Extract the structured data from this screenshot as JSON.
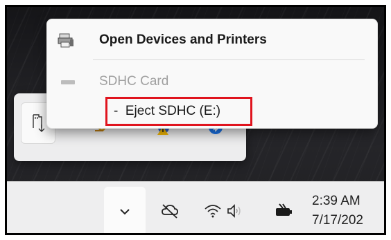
{
  "context_menu": {
    "open_devices_label": "Open Devices and Printers",
    "device_label": "SDHC Card",
    "eject_label": "-  Eject SDHC (E:)"
  },
  "taskbar": {
    "time": "2:39 AM",
    "date": "7/17/202"
  },
  "icons": {
    "open_devices": "devices-printers-icon",
    "sd_card": "sd-card-icon",
    "usb_eject": "usb-eject-icon",
    "chevron": "chevron-down-icon",
    "onedrive": "onedrive-offline-icon",
    "wifi": "wifi-icon",
    "volume": "speaker-icon",
    "battery": "battery-icon",
    "bluetooth": "bluetooth-icon",
    "security": "security-warning-icon"
  },
  "colors": {
    "highlight_box": "#e0141e",
    "bluetooth": "#1a73e8",
    "warning": "#f2b705"
  }
}
